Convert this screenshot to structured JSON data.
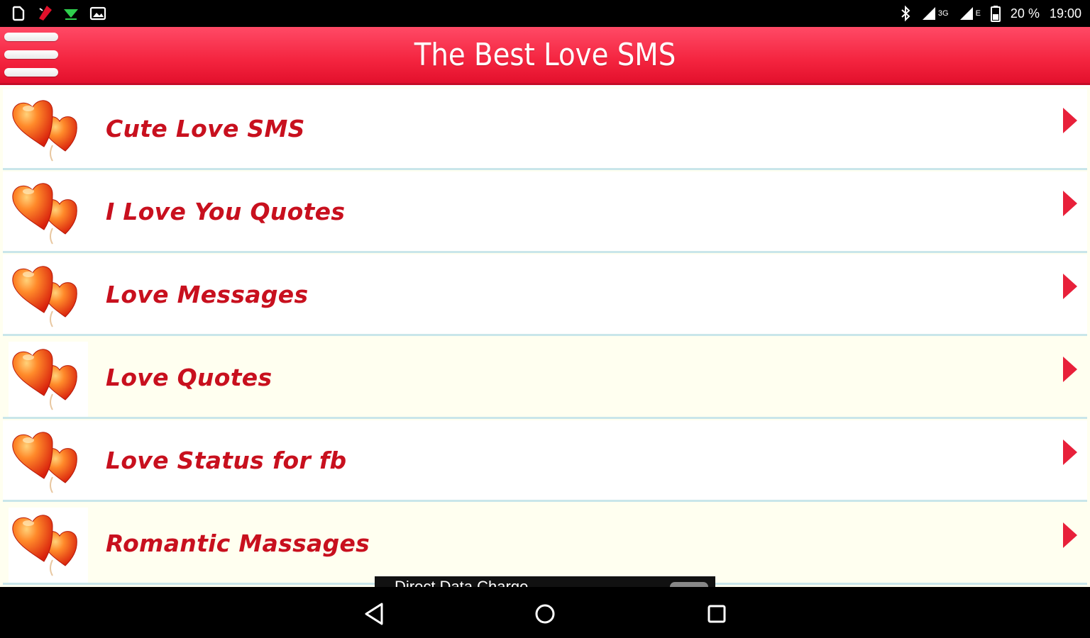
{
  "status_bar": {
    "sub_3g": "3G",
    "sub_e": "E",
    "battery": "20 %",
    "time": "19:00"
  },
  "app_bar": {
    "title": "The Best Love SMS"
  },
  "menu": {
    "items": [
      {
        "label": "Cute Love SMS"
      },
      {
        "label": "I Love You Quotes"
      },
      {
        "label": "Love Messages"
      },
      {
        "label": "Love Quotes"
      },
      {
        "label": "Love Status for fb"
      },
      {
        "label": "Romantic Massages"
      }
    ]
  },
  "ad_banner": {
    "text": "Direct Data Charge ..."
  },
  "colors": {
    "accent": "#f4243f",
    "label": "#c8101e",
    "row_white": "#ffffff",
    "row_cream": "#fffff0",
    "divider": "#c9e6ea"
  }
}
